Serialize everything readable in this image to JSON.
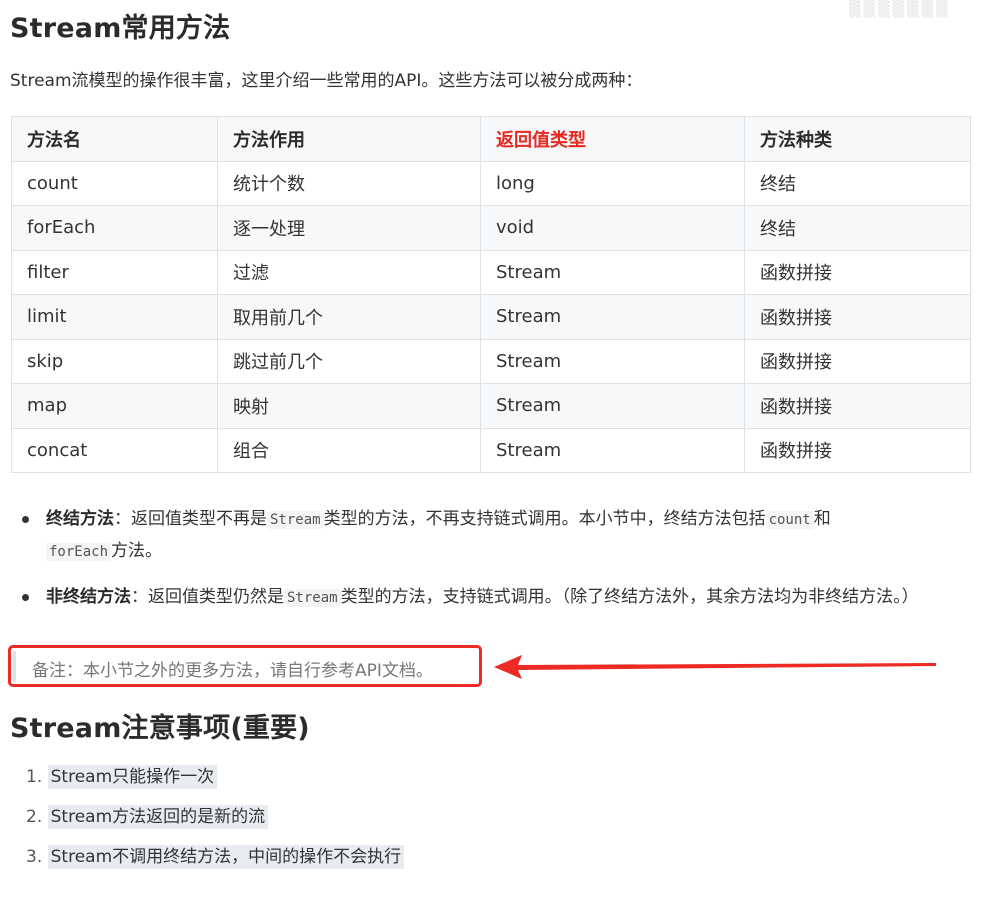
{
  "title": "Stream常用方法",
  "intro": "Stream流模型的操作很丰富，这里介绍一些常用的API。这些方法可以被分成两种：",
  "table": {
    "headers": [
      "方法名",
      "方法作用",
      "返回值类型",
      "方法种类"
    ],
    "rows": [
      [
        "count",
        "统计个数",
        "long",
        "终结"
      ],
      [
        "forEach",
        "逐一处理",
        "void",
        "终结"
      ],
      [
        "filter",
        "过滤",
        "Stream",
        "函数拼接"
      ],
      [
        "limit",
        "取用前几个",
        "Stream",
        "函数拼接"
      ],
      [
        "skip",
        "跳过前几个",
        "Stream",
        "函数拼接"
      ],
      [
        "map",
        "映射",
        "Stream",
        "函数拼接"
      ],
      [
        "concat",
        "组合",
        "Stream",
        "函数拼接"
      ]
    ]
  },
  "bullets": {
    "b1": {
      "term": "终结方法",
      "t1": "：返回值类型不再是",
      "c1": "Stream",
      "t2": "类型的方法，不再支持链式调用。本小节中，终结方法包括",
      "c2": "count",
      "t3": "和",
      "c3": "forEach",
      "t4": "方法。"
    },
    "b2": {
      "term": "非终结方法",
      "t1": "：返回值类型仍然是",
      "c1": "Stream",
      "t2": "类型的方法，支持链式调用。（除了终结方法外，其余方法均为非终结方法。）"
    }
  },
  "note": "备注：本小节之外的更多方法，请自行参考API文档。",
  "title2": "Stream注意事项(重要)",
  "tips": [
    {
      "num": "1.",
      "text": "Stream只能操作一次"
    },
    {
      "num": "2.",
      "text": "Stream方法返回的是新的流"
    },
    {
      "num": "3.",
      "text": "Stream不调用终结方法，中间的操作不会执行"
    }
  ],
  "colors": {
    "highlight_header": "#e8281f",
    "annotation_red": "#ee2a24"
  },
  "icons": [
    "annotation-arrow-icon"
  ]
}
